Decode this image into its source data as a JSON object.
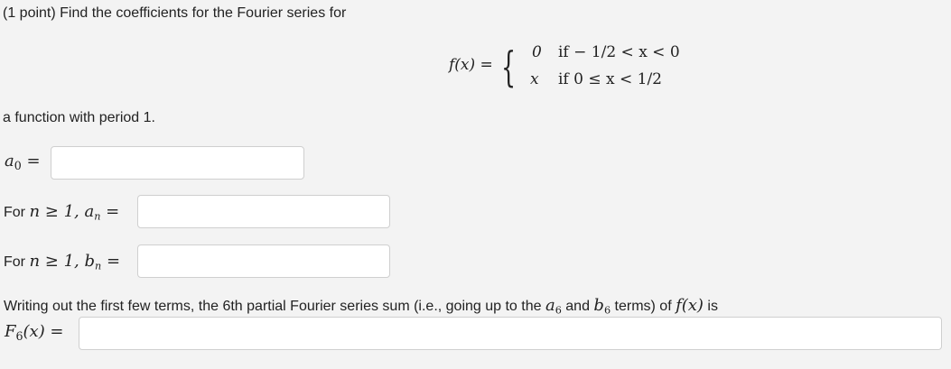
{
  "problem": {
    "intro": "(1 point) Find the coefficients for the Fourier series for",
    "function_lhs": "f(x) =",
    "cases": [
      {
        "value": "0",
        "condition": "if  − 1/2 < x < 0"
      },
      {
        "value": "x",
        "condition": "if 0 ≤ x < 1/2"
      }
    ],
    "period_text": "a function with period 1."
  },
  "fields": {
    "a0": {
      "label": "a",
      "subscript": "0",
      "equals": " =",
      "value": ""
    },
    "an": {
      "prefix": "For ",
      "condition": "n ≥ 1, ",
      "coef": "a",
      "subscript": "n",
      "equals": " =",
      "value": ""
    },
    "bn": {
      "prefix": "For ",
      "condition": "n ≥ 1, ",
      "coef": "b",
      "subscript": "n",
      "equals": " =",
      "value": ""
    },
    "f6": {
      "label": "F",
      "subscript": "6",
      "arg": "(x) =",
      "value": ""
    }
  },
  "partial_sum": {
    "text_before": "Writing out the first few terms, the 6th partial Fourier series sum (i.e., going up to the ",
    "a6": "a",
    "a6_sub": "6",
    "and": " and ",
    "b6": "b",
    "b6_sub": "6",
    "text_after": " terms) of ",
    "fx": "f(x)",
    "is": " is"
  }
}
